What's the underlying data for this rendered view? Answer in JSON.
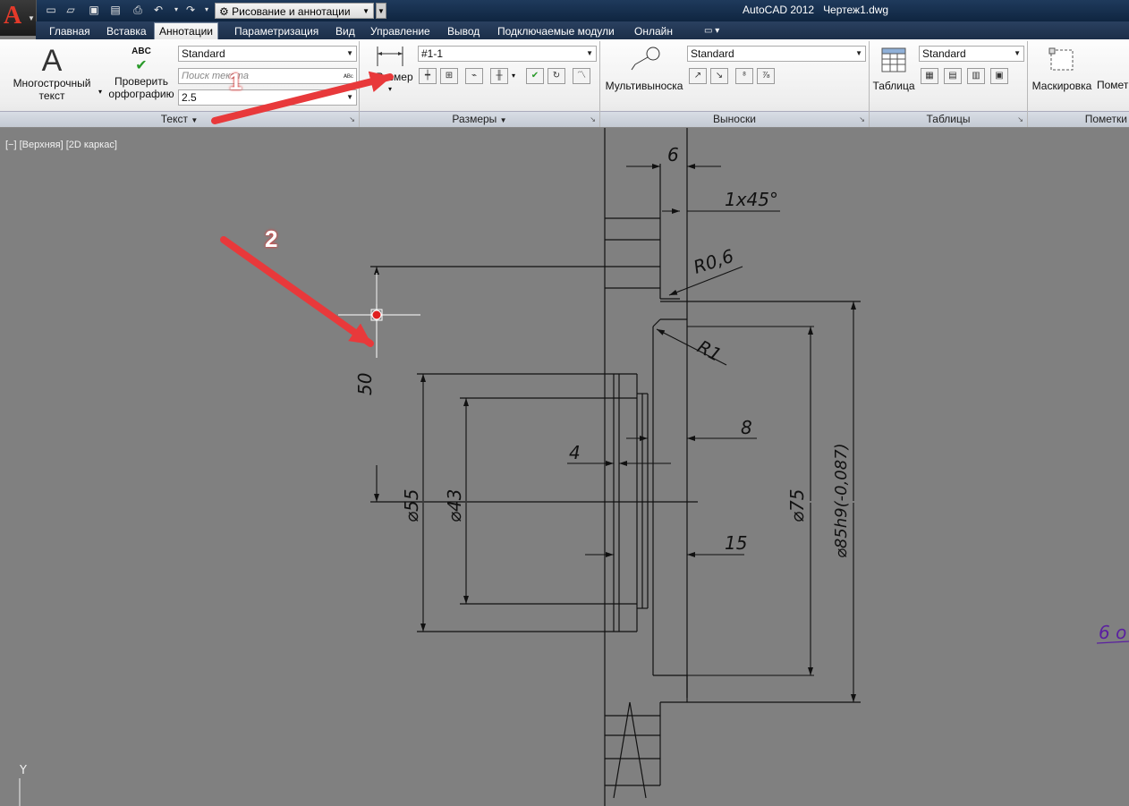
{
  "window": {
    "app_name": "AutoCAD 2012",
    "file_name": "Чертеж1.dwg"
  },
  "quick_access": {
    "workspace": "Рисование и аннотации"
  },
  "tabs": [
    "Главная",
    "Вставка",
    "Аннотации",
    "Параметризация",
    "Вид",
    "Управление",
    "Вывод",
    "Подключаемые модули",
    "Онлайн"
  ],
  "active_tab": "Аннотации",
  "ribbon": {
    "text_panel": {
      "title": "Текст",
      "mtext_label_1": "Многострочный",
      "mtext_label_2": "текст",
      "spell_icon_text": "ABC",
      "spell_label_1": "Проверить",
      "spell_label_2": "орфографию",
      "text_style": "Standard",
      "find_placeholder": "Поиск текста",
      "text_height": "2.5"
    },
    "dim_panel": {
      "title": "Размеры",
      "dim_label": "Размер",
      "dim_style": "#1-1"
    },
    "leader_panel": {
      "title": "Выноски",
      "mleader_label": "Мультивыноска",
      "mleader_style": "Standard"
    },
    "table_panel": {
      "title": "Таблицы",
      "table_label": "Таблица",
      "table_style": "Standard"
    },
    "markup_panel": {
      "title": "Пометки",
      "wipeout_label": "Маскировка",
      "markup_label": "Помет"
    }
  },
  "viewport": {
    "label": "[−] [Верхняя] [2D каркас]"
  },
  "drawing": {
    "dims": [
      "6",
      "1x45°",
      "R0,6",
      "R1",
      "50",
      "⌀55",
      "⌀43",
      "4",
      "8",
      "⌀75",
      "⌀85h9(-0,087)",
      "15"
    ],
    "annotation_side": "6 о",
    "ucs_y": "Y"
  },
  "callouts": {
    "one": "1",
    "two": "2"
  },
  "colors": {
    "arrow": "#e8393b",
    "canvas": "#808080",
    "line": "#111111",
    "crosshair": "#ffffff",
    "side_note": "#5a1fa0"
  }
}
